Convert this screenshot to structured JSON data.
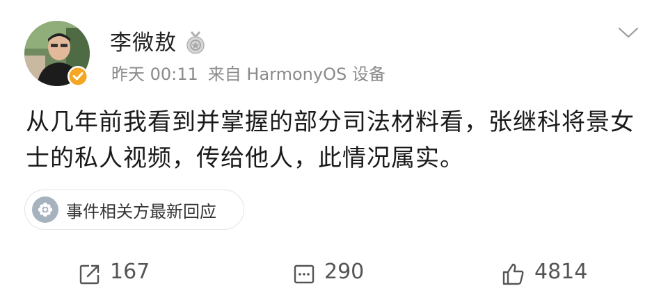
{
  "post": {
    "author": {
      "name": "李微敖",
      "avatar_icon": "avatar-photo",
      "badge_icon": "verified-badge-icon",
      "medal_icon": "medal-icon"
    },
    "meta": {
      "time": "昨天 00:11",
      "source": "来自 HarmonyOS 设备"
    },
    "content": "从几年前我看到并掌握的部分司法材料看，张继科将景女士的私人视频，传给他人，此情况属实。",
    "event_tag": {
      "label": "事件相关方最新回应",
      "icon": "event-icon"
    },
    "actions": {
      "reposts": "167",
      "comments": "290",
      "likes": "4814"
    }
  },
  "colors": {
    "text": "#1a1a1a",
    "meta": "#8a8a8a",
    "badge": "#f5a623",
    "border": "#e3e3e3"
  }
}
